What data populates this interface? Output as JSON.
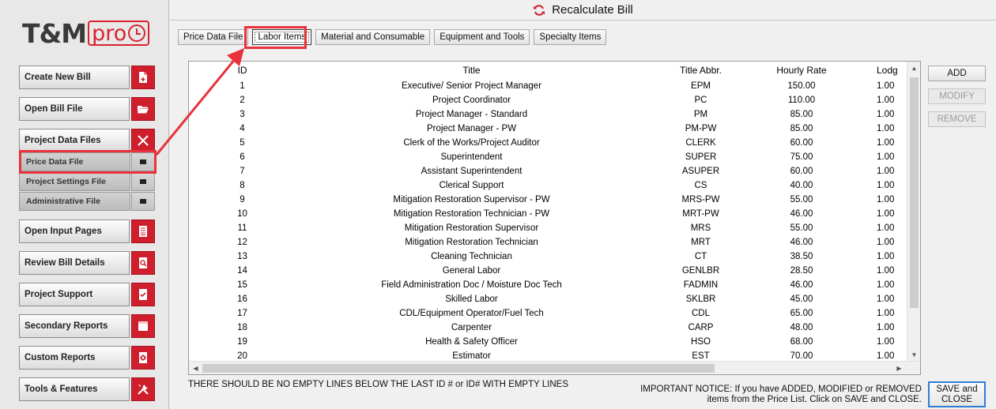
{
  "app": {
    "logo_text": "T&M",
    "logo_pro": "pro",
    "window_title": "Recalculate Bill"
  },
  "sidebar": {
    "buttons": [
      {
        "label": "Create New Bill",
        "icon": "new-file-icon"
      },
      {
        "label": "Open Bill File",
        "icon": "folder-open-icon"
      },
      {
        "label": "Project Data Files",
        "icon": "close-x-icon"
      },
      {
        "label": "Open Input Pages",
        "icon": "input-pages-icon"
      },
      {
        "label": "Review Bill Details",
        "icon": "magnify-document-icon"
      },
      {
        "label": "Project Support",
        "icon": "checklist-icon"
      },
      {
        "label": "Secondary Reports",
        "icon": "report-icon"
      },
      {
        "label": "Custom Reports",
        "icon": "gear-document-icon"
      },
      {
        "label": "Tools & Features",
        "icon": "tools-icon"
      }
    ],
    "sub_items": [
      {
        "label": "Price Data File"
      },
      {
        "label": "Project Settings File"
      },
      {
        "label": "Administrative File"
      }
    ]
  },
  "tabs": [
    {
      "label": "Price Data File"
    },
    {
      "label": "Labor Items"
    },
    {
      "label": "Material and Consumable"
    },
    {
      "label": "Equipment and Tools"
    },
    {
      "label": "Specialty Items"
    }
  ],
  "active_tab": "Labor Items",
  "grid": {
    "columns": {
      "id": "ID",
      "title": "Title",
      "abbr": "Title Abbr.",
      "rate": "Hourly Rate",
      "lodg": "Lodg"
    },
    "rows": [
      {
        "id": "1",
        "title": "Executive/ Senior Project Manager",
        "abbr": "EPM",
        "rate": "150.00",
        "lodg": "1.00"
      },
      {
        "id": "2",
        "title": "Project Coordinator",
        "abbr": "PC",
        "rate": "110.00",
        "lodg": "1.00"
      },
      {
        "id": "3",
        "title": "Project Manager - Standard",
        "abbr": "PM",
        "rate": "85.00",
        "lodg": "1.00"
      },
      {
        "id": "4",
        "title": "Project Manager - PW",
        "abbr": "PM-PW",
        "rate": "85.00",
        "lodg": "1.00"
      },
      {
        "id": "5",
        "title": "Clerk of the Works/Project Auditor",
        "abbr": "CLERK",
        "rate": "60.00",
        "lodg": "1.00"
      },
      {
        "id": "6",
        "title": "Superintendent",
        "abbr": "SUPER",
        "rate": "75.00",
        "lodg": "1.00"
      },
      {
        "id": "7",
        "title": "Assistant Superintendent",
        "abbr": "ASUPER",
        "rate": "60.00",
        "lodg": "1.00"
      },
      {
        "id": "8",
        "title": "Clerical Support",
        "abbr": "CS",
        "rate": "40.00",
        "lodg": "1.00"
      },
      {
        "id": "9",
        "title": "Mitigation Restoration Supervisor - PW",
        "abbr": "MRS-PW",
        "rate": "55.00",
        "lodg": "1.00"
      },
      {
        "id": "10",
        "title": "Mitigation Restoration Technician - PW",
        "abbr": "MRT-PW",
        "rate": "46.00",
        "lodg": "1.00"
      },
      {
        "id": "11",
        "title": "Mitigation Restoration Supervisor",
        "abbr": "MRS",
        "rate": "55.00",
        "lodg": "1.00"
      },
      {
        "id": "12",
        "title": "Mitigation Restoration Technician",
        "abbr": "MRT",
        "rate": "46.00",
        "lodg": "1.00"
      },
      {
        "id": "13",
        "title": "Cleaning Technician",
        "abbr": "CT",
        "rate": "38.50",
        "lodg": "1.00"
      },
      {
        "id": "14",
        "title": "General Labor",
        "abbr": "GENLBR",
        "rate": "28.50",
        "lodg": "1.00"
      },
      {
        "id": "15",
        "title": "Field Administration Doc / Moisture Doc Tech",
        "abbr": "FADMIN",
        "rate": "46.00",
        "lodg": "1.00"
      },
      {
        "id": "16",
        "title": "Skilled Labor",
        "abbr": "SKLBR",
        "rate": "45.00",
        "lodg": "1.00"
      },
      {
        "id": "17",
        "title": "CDL/Equipment Operator/Fuel Tech",
        "abbr": "CDL",
        "rate": "65.00",
        "lodg": "1.00"
      },
      {
        "id": "18",
        "title": "Carpenter",
        "abbr": "CARP",
        "rate": "48.00",
        "lodg": "1.00"
      },
      {
        "id": "19",
        "title": "Health & Safety Officer",
        "abbr": "HSO",
        "rate": "68.00",
        "lodg": "1.00"
      },
      {
        "id": "20",
        "title": "Estimator",
        "abbr": "EST",
        "rate": "70.00",
        "lodg": "1.00"
      }
    ]
  },
  "actions": {
    "add": "ADD",
    "modify": "MODIFY",
    "remove": "REMOVE",
    "save_line1": "SAVE and",
    "save_line2": "CLOSE"
  },
  "messages": {
    "warning": "THERE SHOULD BE NO EMPTY LINES BELOW THE LAST ID # or ID# WITH EMPTY LINES",
    "notice_line1": "IMPORTANT NOTICE:  If you have ADDED, MODIFIED or REMOVED",
    "notice_line2": "items from the Price List.  Click on SAVE and CLOSE."
  },
  "colors": {
    "brand_red": "#cf1f2c",
    "annotation_red": "#e9323c",
    "focus_blue": "#2a7ed3"
  }
}
